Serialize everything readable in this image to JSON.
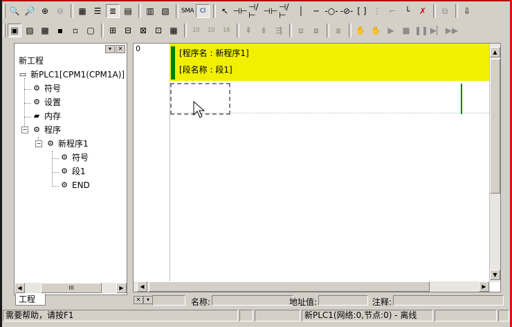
{
  "project_tree": {
    "root": "新工程",
    "plc": "新PLC1[CPM1(CPM1A)]",
    "symbols": "符号",
    "settings": "设置",
    "memory": "内存",
    "programs": "程序",
    "new_program": "新程序1",
    "prog_symbols": "符号",
    "section1": "段1",
    "end": "END",
    "tab_label": "工程",
    "scroll_thumb": "III"
  },
  "ladder": {
    "rung_number": "0",
    "program_name_line": "[程序名 : 新程序1]",
    "section_name_line": "[段名称 : 段1]"
  },
  "fields": {
    "name_label": "名称:",
    "address_label": "地址值:",
    "comment_label": "注释:"
  },
  "status": {
    "help_text": "需要帮助，请按F1",
    "plc_state": "新PLC1(网络:0,节点:0) - 离线"
  },
  "toolbar2": {
    "b10a": "10",
    "b10b": "10",
    "b16": "16"
  },
  "colors": {
    "header_yellow": "#f0f000",
    "rail_green": "#008000"
  }
}
